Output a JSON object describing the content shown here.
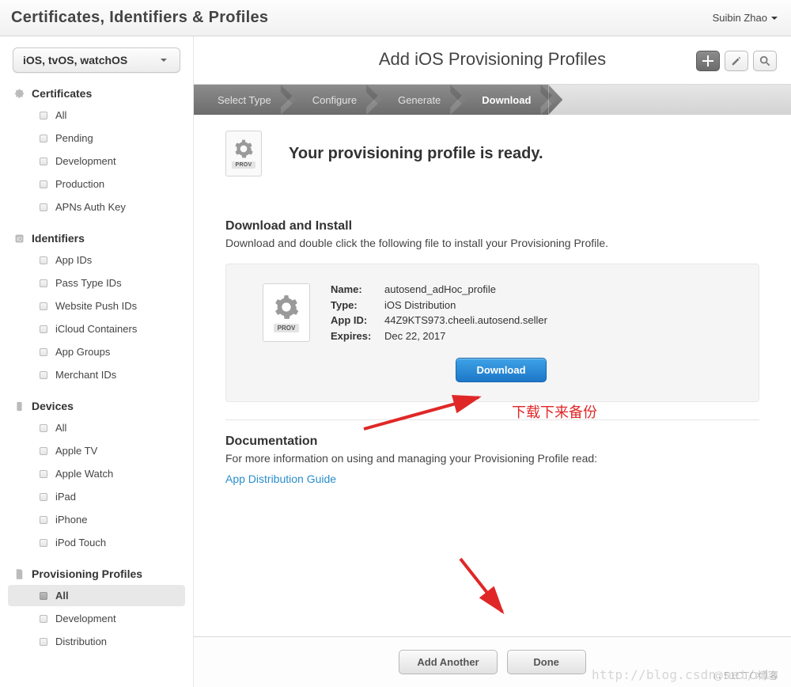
{
  "header": {
    "title": "Certificates, Identifiers & Profiles",
    "user_name": "Suibin Zhao"
  },
  "sidebar": {
    "platform_select": "iOS, tvOS, watchOS",
    "sections": [
      {
        "title": "Certificates",
        "items": [
          "All",
          "Pending",
          "Development",
          "Production",
          "APNs Auth Key"
        ]
      },
      {
        "title": "Identifiers",
        "items": [
          "App IDs",
          "Pass Type IDs",
          "Website Push IDs",
          "iCloud Containers",
          "App Groups",
          "Merchant IDs"
        ]
      },
      {
        "title": "Devices",
        "items": [
          "All",
          "Apple TV",
          "Apple Watch",
          "iPad",
          "iPhone",
          "iPod Touch"
        ]
      },
      {
        "title": "Provisioning Profiles",
        "items": [
          "All",
          "Development",
          "Distribution"
        ],
        "active_index": 0
      }
    ]
  },
  "main": {
    "title": "Add iOS Provisioning Profiles",
    "steps": [
      "Select Type",
      "Configure",
      "Generate",
      "Download"
    ],
    "active_step": 3,
    "ready_heading": "Your provisioning profile is ready.",
    "download_section": {
      "heading": "Download and Install",
      "desc": "Download and double click the following file to install your Provisioning Profile."
    },
    "profile": {
      "name_label": "Name:",
      "name_value": "autosend_adHoc_profile",
      "type_label": "Type:",
      "type_value": "iOS Distribution",
      "appid_label": "App ID:",
      "appid_value": "44Z9KTS973.cheeli.autosend.seller",
      "expires_label": "Expires:",
      "expires_value": "Dec 22, 2017",
      "download_btn": "Download",
      "prov_caption": "PROV"
    },
    "doc_section": {
      "heading": "Documentation",
      "desc": "For more information on using and managing your Provisioning Profile read:",
      "link": "App Distribution Guide"
    },
    "footer": {
      "add_another": "Add Another",
      "done": "Done"
    }
  },
  "annotations": {
    "text1": "下载下来备份"
  },
  "watermark1": "http://blog.csdn.net/xia",
  "watermark2": "@51CTO博客"
}
